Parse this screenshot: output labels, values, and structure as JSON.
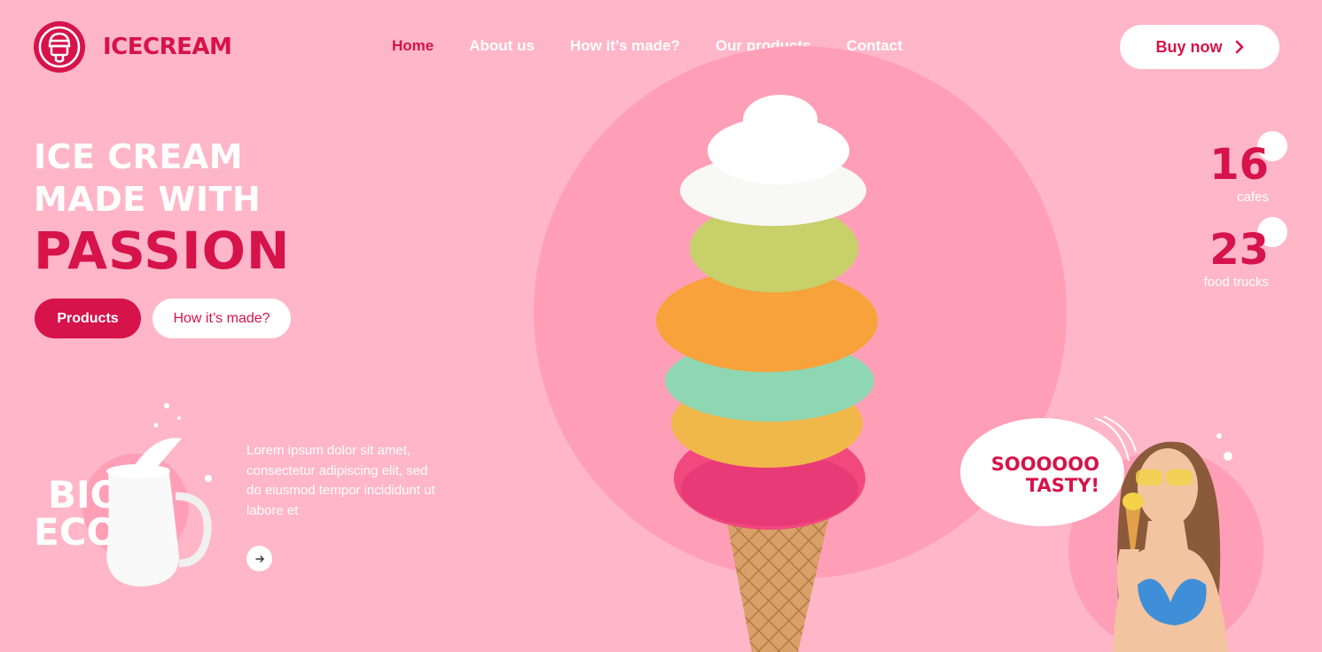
{
  "brand": {
    "name": "ICECREAM"
  },
  "nav": {
    "items": [
      {
        "label": "Home",
        "active": true
      },
      {
        "label": "About us",
        "active": false
      },
      {
        "label": "How it’s made?",
        "active": false
      },
      {
        "label": "Our products",
        "active": false
      },
      {
        "label": "Contact",
        "active": false
      }
    ]
  },
  "header": {
    "buy_label": "Buy now"
  },
  "hero": {
    "line1": "ICE CREAM",
    "line2": "MADE WITH",
    "line3": "PASSION",
    "primary_btn": "Products",
    "secondary_btn": "How it’s made?"
  },
  "stats": [
    {
      "value": "16",
      "label": "cafes"
    },
    {
      "value": "23",
      "label": "food trucks"
    }
  ],
  "bio": {
    "line1": "BIO",
    "line2": "ECO",
    "text": "Lorem ipsum dolor sit amet, consectetur adipiscing elit, sed do eiusmod tempor incididunt ut labore et"
  },
  "tasty": {
    "line1": "SOOOOOO",
    "line2": "TASTY!"
  },
  "colors": {
    "background": "#ffb6c8",
    "accent": "#d6134a",
    "circle": "#ff9fb7",
    "white": "#ffffff"
  },
  "icons": [
    "logo-icon",
    "chevron-right-icon",
    "arrow-right-icon"
  ]
}
